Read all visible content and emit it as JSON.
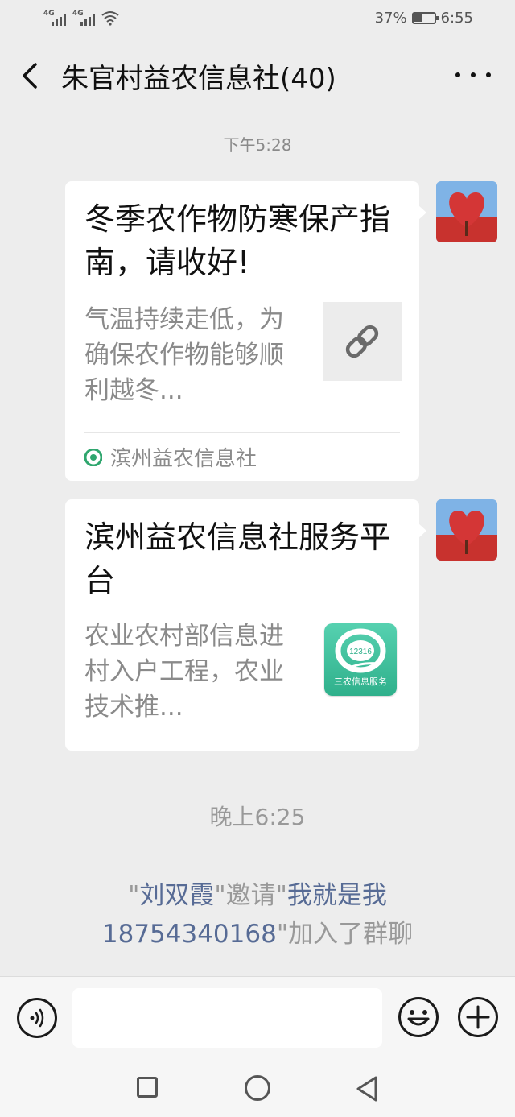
{
  "status_bar": {
    "sim1_label": "4G",
    "sim2_label": "4G",
    "battery": "37%",
    "battery_level": 0.37,
    "time": "6:55"
  },
  "header": {
    "title": "朱官村益农信息社(40)"
  },
  "messages": [
    {
      "time": "下午5:28",
      "title": "冬季农作物防寒保产指南，请收好!",
      "description": "气温持续走低，为确保农作物能够顺利越冬...",
      "source": "滨州益农信息社",
      "thumbnail": "link-icon"
    },
    {
      "title": "滨州益农信息社服务平台",
      "description": "农业农村部信息进村入户工程，农业技术推...",
      "thumbnail": "12316-app-icon",
      "app_badge_text": "12316",
      "app_caption": "三农信息服务"
    }
  ],
  "evening_time": "晚上6:25",
  "system_notice": {
    "inviter": "刘双霞",
    "action": "邀请",
    "invitee": "我就是我18754340168",
    "suffix": "加入了群聊"
  },
  "colors": {
    "background": "#ededed",
    "card": "#ffffff",
    "link_name": "#576b95",
    "muted_text": "#8a8a8a",
    "app_green": "#2fb08b"
  }
}
